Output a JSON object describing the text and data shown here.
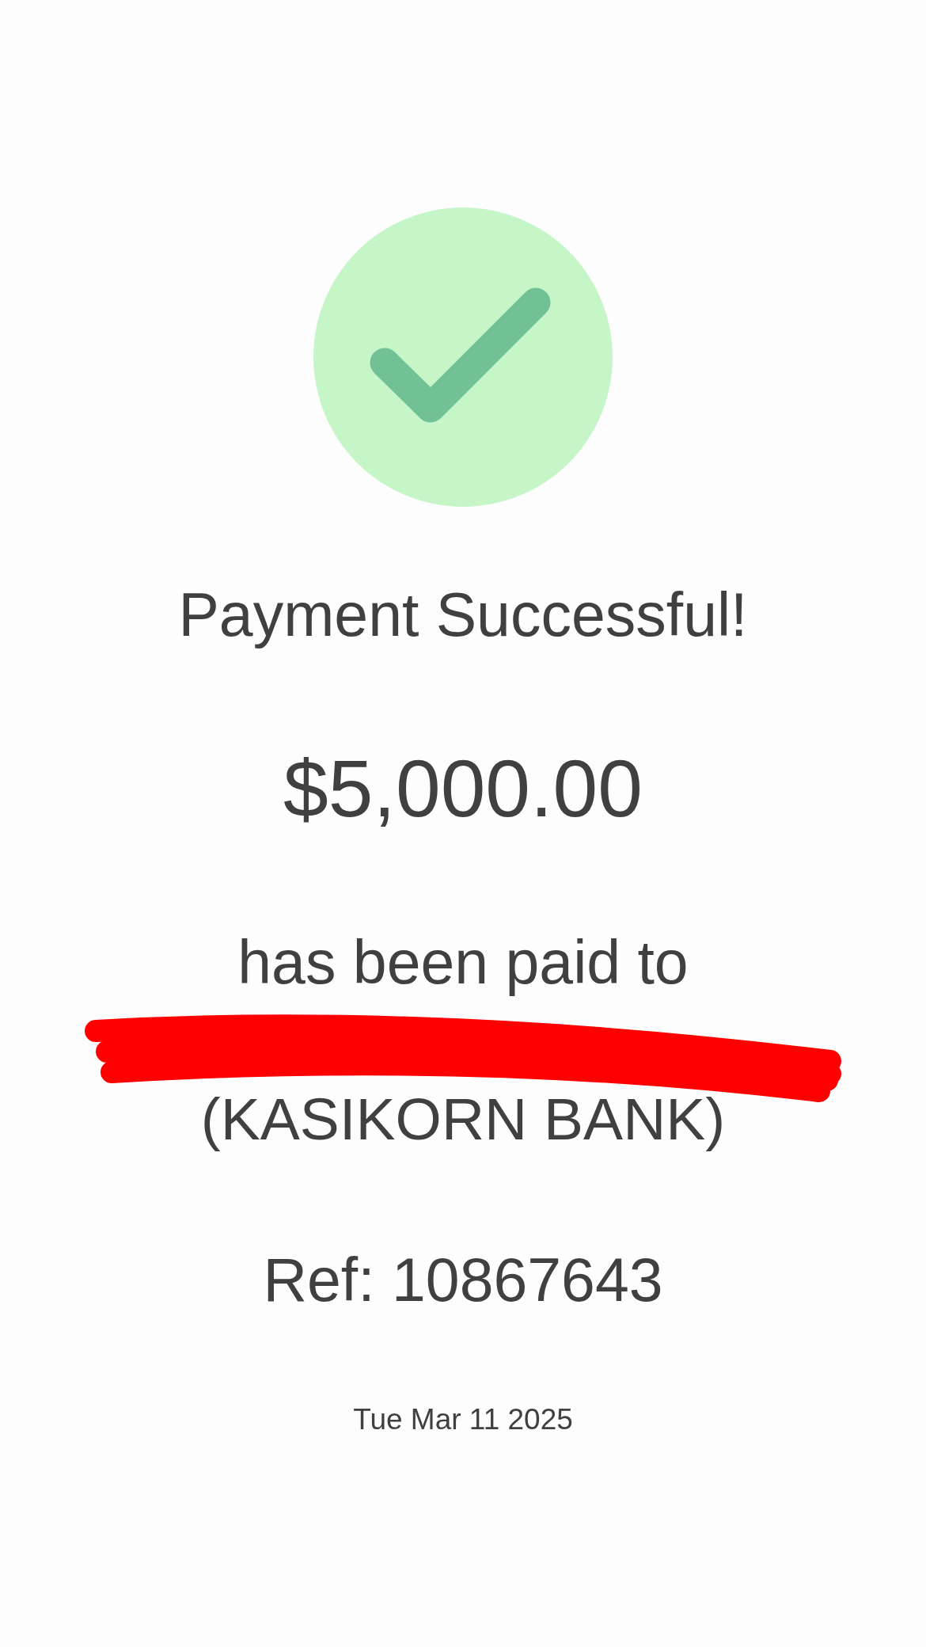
{
  "title": "Payment Successful!",
  "amount": "$5,000.00",
  "recipient": {
    "intro": "has been paid to",
    "name_redacted": true,
    "bank": "(KASIKORN BANK)"
  },
  "reference": "Ref: 10867643",
  "date": "Tue Mar 11 2025"
}
